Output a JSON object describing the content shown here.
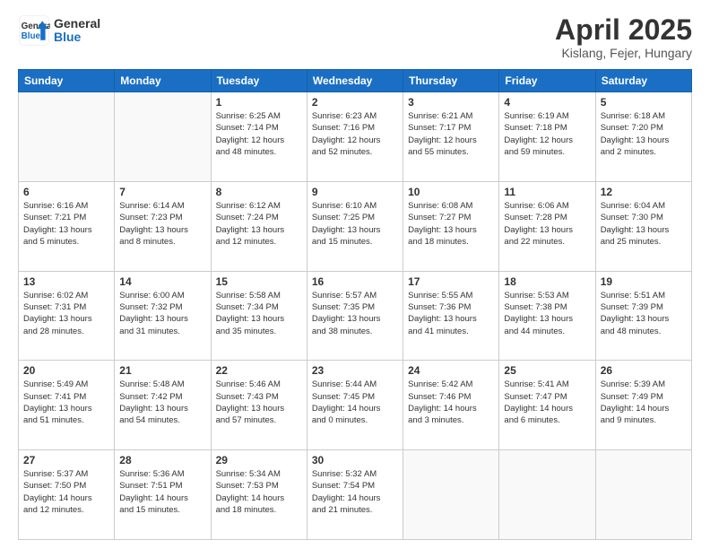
{
  "header": {
    "logo_line1": "General",
    "logo_line2": "Blue",
    "title": "April 2025",
    "subtitle": "Kislang, Fejer, Hungary"
  },
  "weekdays": [
    "Sunday",
    "Monday",
    "Tuesday",
    "Wednesday",
    "Thursday",
    "Friday",
    "Saturday"
  ],
  "weeks": [
    [
      {
        "day": "",
        "info": ""
      },
      {
        "day": "",
        "info": ""
      },
      {
        "day": "1",
        "info": "Sunrise: 6:25 AM\nSunset: 7:14 PM\nDaylight: 12 hours\nand 48 minutes."
      },
      {
        "day": "2",
        "info": "Sunrise: 6:23 AM\nSunset: 7:16 PM\nDaylight: 12 hours\nand 52 minutes."
      },
      {
        "day": "3",
        "info": "Sunrise: 6:21 AM\nSunset: 7:17 PM\nDaylight: 12 hours\nand 55 minutes."
      },
      {
        "day": "4",
        "info": "Sunrise: 6:19 AM\nSunset: 7:18 PM\nDaylight: 12 hours\nand 59 minutes."
      },
      {
        "day": "5",
        "info": "Sunrise: 6:18 AM\nSunset: 7:20 PM\nDaylight: 13 hours\nand 2 minutes."
      }
    ],
    [
      {
        "day": "6",
        "info": "Sunrise: 6:16 AM\nSunset: 7:21 PM\nDaylight: 13 hours\nand 5 minutes."
      },
      {
        "day": "7",
        "info": "Sunrise: 6:14 AM\nSunset: 7:23 PM\nDaylight: 13 hours\nand 8 minutes."
      },
      {
        "day": "8",
        "info": "Sunrise: 6:12 AM\nSunset: 7:24 PM\nDaylight: 13 hours\nand 12 minutes."
      },
      {
        "day": "9",
        "info": "Sunrise: 6:10 AM\nSunset: 7:25 PM\nDaylight: 13 hours\nand 15 minutes."
      },
      {
        "day": "10",
        "info": "Sunrise: 6:08 AM\nSunset: 7:27 PM\nDaylight: 13 hours\nand 18 minutes."
      },
      {
        "day": "11",
        "info": "Sunrise: 6:06 AM\nSunset: 7:28 PM\nDaylight: 13 hours\nand 22 minutes."
      },
      {
        "day": "12",
        "info": "Sunrise: 6:04 AM\nSunset: 7:30 PM\nDaylight: 13 hours\nand 25 minutes."
      }
    ],
    [
      {
        "day": "13",
        "info": "Sunrise: 6:02 AM\nSunset: 7:31 PM\nDaylight: 13 hours\nand 28 minutes."
      },
      {
        "day": "14",
        "info": "Sunrise: 6:00 AM\nSunset: 7:32 PM\nDaylight: 13 hours\nand 31 minutes."
      },
      {
        "day": "15",
        "info": "Sunrise: 5:58 AM\nSunset: 7:34 PM\nDaylight: 13 hours\nand 35 minutes."
      },
      {
        "day": "16",
        "info": "Sunrise: 5:57 AM\nSunset: 7:35 PM\nDaylight: 13 hours\nand 38 minutes."
      },
      {
        "day": "17",
        "info": "Sunrise: 5:55 AM\nSunset: 7:36 PM\nDaylight: 13 hours\nand 41 minutes."
      },
      {
        "day": "18",
        "info": "Sunrise: 5:53 AM\nSunset: 7:38 PM\nDaylight: 13 hours\nand 44 minutes."
      },
      {
        "day": "19",
        "info": "Sunrise: 5:51 AM\nSunset: 7:39 PM\nDaylight: 13 hours\nand 48 minutes."
      }
    ],
    [
      {
        "day": "20",
        "info": "Sunrise: 5:49 AM\nSunset: 7:41 PM\nDaylight: 13 hours\nand 51 minutes."
      },
      {
        "day": "21",
        "info": "Sunrise: 5:48 AM\nSunset: 7:42 PM\nDaylight: 13 hours\nand 54 minutes."
      },
      {
        "day": "22",
        "info": "Sunrise: 5:46 AM\nSunset: 7:43 PM\nDaylight: 13 hours\nand 57 minutes."
      },
      {
        "day": "23",
        "info": "Sunrise: 5:44 AM\nSunset: 7:45 PM\nDaylight: 14 hours\nand 0 minutes."
      },
      {
        "day": "24",
        "info": "Sunrise: 5:42 AM\nSunset: 7:46 PM\nDaylight: 14 hours\nand 3 minutes."
      },
      {
        "day": "25",
        "info": "Sunrise: 5:41 AM\nSunset: 7:47 PM\nDaylight: 14 hours\nand 6 minutes."
      },
      {
        "day": "26",
        "info": "Sunrise: 5:39 AM\nSunset: 7:49 PM\nDaylight: 14 hours\nand 9 minutes."
      }
    ],
    [
      {
        "day": "27",
        "info": "Sunrise: 5:37 AM\nSunset: 7:50 PM\nDaylight: 14 hours\nand 12 minutes."
      },
      {
        "day": "28",
        "info": "Sunrise: 5:36 AM\nSunset: 7:51 PM\nDaylight: 14 hours\nand 15 minutes."
      },
      {
        "day": "29",
        "info": "Sunrise: 5:34 AM\nSunset: 7:53 PM\nDaylight: 14 hours\nand 18 minutes."
      },
      {
        "day": "30",
        "info": "Sunrise: 5:32 AM\nSunset: 7:54 PM\nDaylight: 14 hours\nand 21 minutes."
      },
      {
        "day": "",
        "info": ""
      },
      {
        "day": "",
        "info": ""
      },
      {
        "day": "",
        "info": ""
      }
    ]
  ]
}
